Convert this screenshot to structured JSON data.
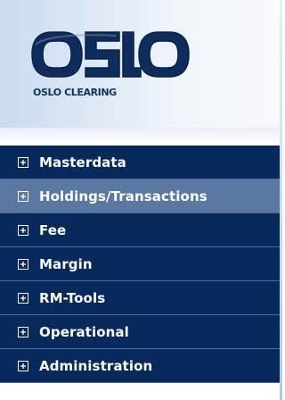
{
  "logo": {
    "icon": "oslo-clearing-logo",
    "mark_text": "OSLO",
    "text": "OSLO CLEARING",
    "color": "#14325e"
  },
  "menu": {
    "items": [
      {
        "label": "Masterdata",
        "icon": "plus-box-icon",
        "active": false
      },
      {
        "label": "Holdings/Transactions",
        "icon": "plus-box-icon",
        "active": true
      },
      {
        "label": "Fee",
        "icon": "plus-box-icon",
        "active": false
      },
      {
        "label": "Margin",
        "icon": "plus-box-icon",
        "active": false
      },
      {
        "label": "RM-Tools",
        "icon": "plus-box-icon",
        "active": false
      },
      {
        "label": "Operational",
        "icon": "plus-box-icon",
        "active": false
      },
      {
        "label": "Administration",
        "icon": "plus-box-icon",
        "active": false
      }
    ]
  },
  "colors": {
    "menu_bg": "#08295b",
    "menu_active_bg": "#5a78a2",
    "menu_text": "#ffffff"
  }
}
